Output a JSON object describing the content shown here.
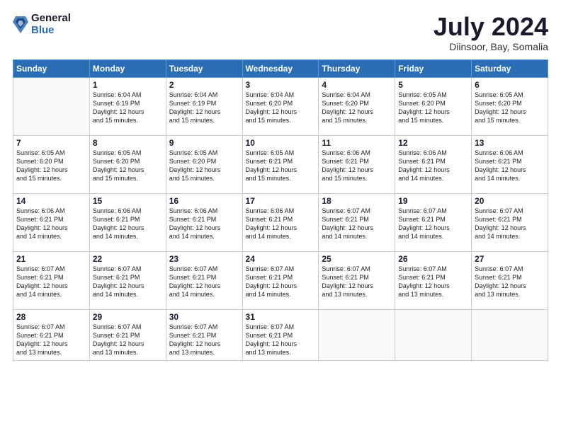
{
  "header": {
    "logo": {
      "general": "General",
      "blue": "Blue"
    },
    "title": "July 2024",
    "location": "Diinsoor, Bay, Somalia"
  },
  "weekdays": [
    "Sunday",
    "Monday",
    "Tuesday",
    "Wednesday",
    "Thursday",
    "Friday",
    "Saturday"
  ],
  "weeks": [
    [
      {
        "day": null,
        "info": null
      },
      {
        "day": "1",
        "sunrise": "6:04 AM",
        "sunset": "6:19 PM",
        "daylight": "12 hours and 15 minutes."
      },
      {
        "day": "2",
        "sunrise": "6:04 AM",
        "sunset": "6:19 PM",
        "daylight": "12 hours and 15 minutes."
      },
      {
        "day": "3",
        "sunrise": "6:04 AM",
        "sunset": "6:20 PM",
        "daylight": "12 hours and 15 minutes."
      },
      {
        "day": "4",
        "sunrise": "6:04 AM",
        "sunset": "6:20 PM",
        "daylight": "12 hours and 15 minutes."
      },
      {
        "day": "5",
        "sunrise": "6:05 AM",
        "sunset": "6:20 PM",
        "daylight": "12 hours and 15 minutes."
      },
      {
        "day": "6",
        "sunrise": "6:05 AM",
        "sunset": "6:20 PM",
        "daylight": "12 hours and 15 minutes."
      }
    ],
    [
      {
        "day": "7",
        "sunrise": "6:05 AM",
        "sunset": "6:20 PM",
        "daylight": "12 hours and 15 minutes."
      },
      {
        "day": "8",
        "sunrise": "6:05 AM",
        "sunset": "6:20 PM",
        "daylight": "12 hours and 15 minutes."
      },
      {
        "day": "9",
        "sunrise": "6:05 AM",
        "sunset": "6:20 PM",
        "daylight": "12 hours and 15 minutes."
      },
      {
        "day": "10",
        "sunrise": "6:05 AM",
        "sunset": "6:21 PM",
        "daylight": "12 hours and 15 minutes."
      },
      {
        "day": "11",
        "sunrise": "6:06 AM",
        "sunset": "6:21 PM",
        "daylight": "12 hours and 15 minutes."
      },
      {
        "day": "12",
        "sunrise": "6:06 AM",
        "sunset": "6:21 PM",
        "daylight": "12 hours and 14 minutes."
      },
      {
        "day": "13",
        "sunrise": "6:06 AM",
        "sunset": "6:21 PM",
        "daylight": "12 hours and 14 minutes."
      }
    ],
    [
      {
        "day": "14",
        "sunrise": "6:06 AM",
        "sunset": "6:21 PM",
        "daylight": "12 hours and 14 minutes."
      },
      {
        "day": "15",
        "sunrise": "6:06 AM",
        "sunset": "6:21 PM",
        "daylight": "12 hours and 14 minutes."
      },
      {
        "day": "16",
        "sunrise": "6:06 AM",
        "sunset": "6:21 PM",
        "daylight": "12 hours and 14 minutes."
      },
      {
        "day": "17",
        "sunrise": "6:06 AM",
        "sunset": "6:21 PM",
        "daylight": "12 hours and 14 minutes."
      },
      {
        "day": "18",
        "sunrise": "6:07 AM",
        "sunset": "6:21 PM",
        "daylight": "12 hours and 14 minutes."
      },
      {
        "day": "19",
        "sunrise": "6:07 AM",
        "sunset": "6:21 PM",
        "daylight": "12 hours and 14 minutes."
      },
      {
        "day": "20",
        "sunrise": "6:07 AM",
        "sunset": "6:21 PM",
        "daylight": "12 hours and 14 minutes."
      }
    ],
    [
      {
        "day": "21",
        "sunrise": "6:07 AM",
        "sunset": "6:21 PM",
        "daylight": "12 hours and 14 minutes."
      },
      {
        "day": "22",
        "sunrise": "6:07 AM",
        "sunset": "6:21 PM",
        "daylight": "12 hours and 14 minutes."
      },
      {
        "day": "23",
        "sunrise": "6:07 AM",
        "sunset": "6:21 PM",
        "daylight": "12 hours and 14 minutes."
      },
      {
        "day": "24",
        "sunrise": "6:07 AM",
        "sunset": "6:21 PM",
        "daylight": "12 hours and 14 minutes."
      },
      {
        "day": "25",
        "sunrise": "6:07 AM",
        "sunset": "6:21 PM",
        "daylight": "12 hours and 13 minutes."
      },
      {
        "day": "26",
        "sunrise": "6:07 AM",
        "sunset": "6:21 PM",
        "daylight": "12 hours and 13 minutes."
      },
      {
        "day": "27",
        "sunrise": "6:07 AM",
        "sunset": "6:21 PM",
        "daylight": "12 hours and 13 minutes."
      }
    ],
    [
      {
        "day": "28",
        "sunrise": "6:07 AM",
        "sunset": "6:21 PM",
        "daylight": "12 hours and 13 minutes."
      },
      {
        "day": "29",
        "sunrise": "6:07 AM",
        "sunset": "6:21 PM",
        "daylight": "12 hours and 13 minutes."
      },
      {
        "day": "30",
        "sunrise": "6:07 AM",
        "sunset": "6:21 PM",
        "daylight": "12 hours and 13 minutes."
      },
      {
        "day": "31",
        "sunrise": "6:07 AM",
        "sunset": "6:21 PM",
        "daylight": "12 hours and 13 minutes."
      },
      {
        "day": null,
        "info": null
      },
      {
        "day": null,
        "info": null
      },
      {
        "day": null,
        "info": null
      }
    ]
  ],
  "labels": {
    "sunrise": "Sunrise:",
    "sunset": "Sunset:",
    "daylight": "Daylight:"
  }
}
